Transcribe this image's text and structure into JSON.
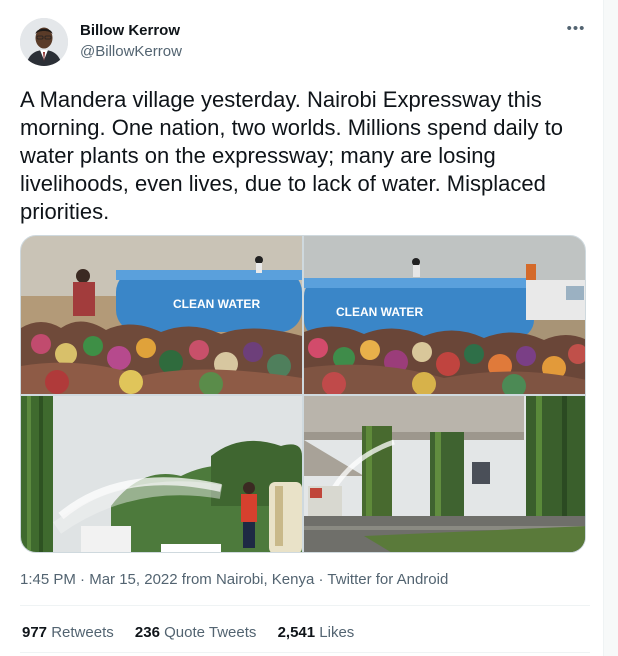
{
  "author": {
    "name": "Billow Kerrow",
    "handle": "@BillowKerrow"
  },
  "more_icon": "•••",
  "tweet": {
    "text": "A Mandera village yesterday. Nairobi Expressway this morning. One nation, two worlds. Millions spend daily to water plants on the expressway; many are losing livelihoods, even lives, due to lack of water. Misplaced priorities."
  },
  "media": {
    "tank_label_left": "CLEAN WATER",
    "tank_label_right": "CLEAN WATER"
  },
  "meta": {
    "time": "1:45 PM",
    "separator": " · ",
    "date": "Mar 15, 2022 from Nairobi, Kenya",
    "source": "Twitter for Android"
  },
  "stats": {
    "retweets_count": "977",
    "retweets_label": "Retweets",
    "quotes_count": "236",
    "quotes_label": "Quote Tweets",
    "likes_count": "2,541",
    "likes_label": "Likes"
  },
  "colors": {
    "text_primary": "#0f1419",
    "text_secondary": "#536471",
    "border": "#cfd9de",
    "tank_blue": "#3a86c8"
  }
}
